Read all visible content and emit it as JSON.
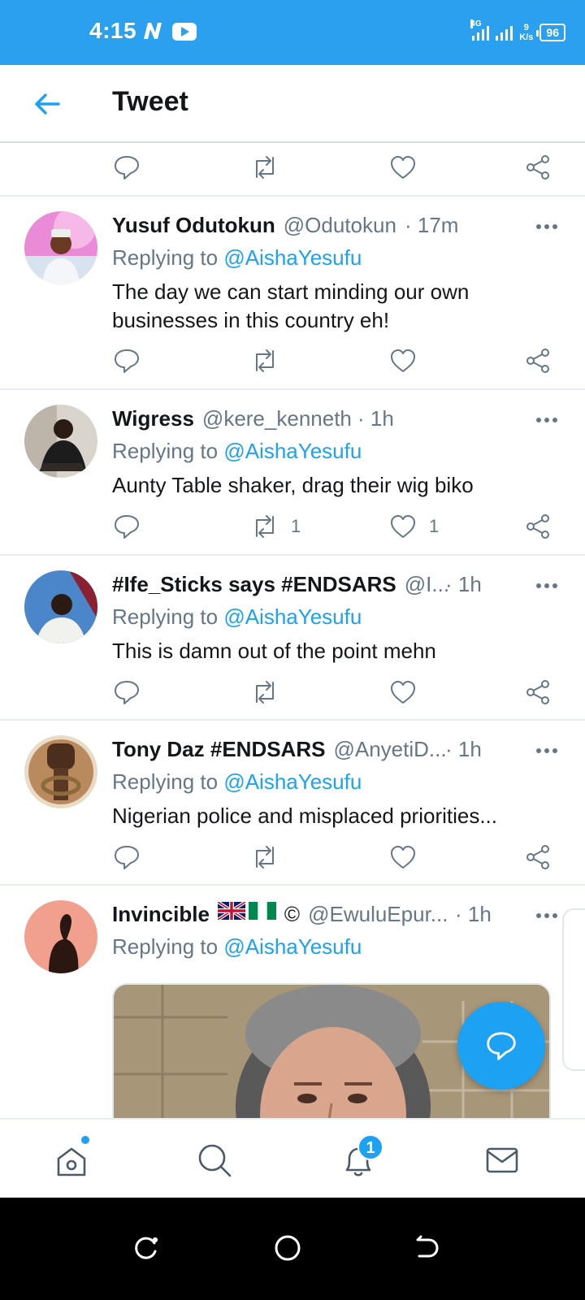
{
  "status_bar": {
    "time": "4:15",
    "network": "4G",
    "speed_value": "9",
    "speed_unit": "K/s",
    "battery": "96"
  },
  "header": {
    "back_icon": "arrow-left-icon",
    "title": "Tweet"
  },
  "tweets": [
    {
      "name": "Yusuf Odutokun",
      "handle": "@Odutokun",
      "time": "· 17m",
      "replying_prefix": "Replying to",
      "replying_to": "@AishaYesufu",
      "text": "The day we can start minding our own businesses in this country eh!",
      "retweets": "",
      "likes": ""
    },
    {
      "name": "Wigress",
      "handle": "@kere_kenneth",
      "time": "· 1h",
      "replying_prefix": "Replying to",
      "replying_to": "@AishaYesufu",
      "text": "Aunty Table shaker, drag their wig biko",
      "retweets": "1",
      "likes": "1"
    },
    {
      "name": "#Ife_Sticks says #ENDSARS",
      "handle": "@I...",
      "time": "· 1h",
      "replying_prefix": "Replying to",
      "replying_to": "@AishaYesufu",
      "text": "This is damn out of the point mehn",
      "retweets": "",
      "likes": ""
    },
    {
      "name": "Tony Daz #ENDSARS",
      "handle": "@AnyetiD...",
      "time": "· 1h",
      "replying_prefix": "Replying to",
      "replying_to": "@AishaYesufu",
      "text": "Nigerian police and misplaced priorities...",
      "retweets": "",
      "likes": ""
    },
    {
      "name": "Invincible",
      "name_suffix": "©",
      "handle": "@EwuluEpur...",
      "time": "· 1h",
      "replying_prefix": "Replying to",
      "replying_to": "@AishaYesufu",
      "text": ""
    }
  ],
  "bottom_nav": {
    "notifications_badge": "1",
    "items": [
      "home-icon",
      "search-icon",
      "bell-icon",
      "mail-icon"
    ]
  },
  "colors": {
    "status_bar": "#2aa0ee",
    "accent": "#1da1f2",
    "muted": "#657786",
    "text": "#14171a"
  }
}
